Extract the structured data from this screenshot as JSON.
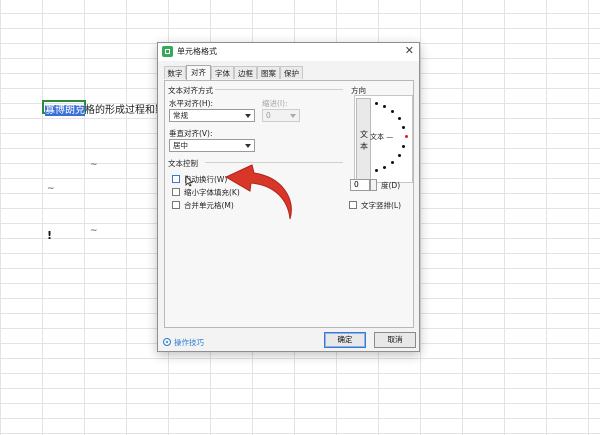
{
  "sheet": {
    "selected_cell_text_highlight": "寡博朗克",
    "selected_cell_text_rest": "格的形成过程和影",
    "row_marker": "!",
    "tilde_mark": "~"
  },
  "dialog": {
    "title": "单元格格式",
    "close_glyph": "✕",
    "tabs": [
      "数字",
      "对齐",
      "字体",
      "边框",
      "图案",
      "保护"
    ],
    "active_tab": "对齐",
    "text_alignment": {
      "group_label": "文本对齐方式",
      "horizontal_label": "水平对齐(H):",
      "horizontal_value": "常规",
      "indent_label": "缩进(I):",
      "indent_value": "0",
      "vertical_label": "垂直对齐(V):",
      "vertical_value": "居中"
    },
    "text_control": {
      "group_label": "文本控制",
      "wrap_text": "自动换行(W)",
      "shrink_to_fit": "缩小字体填充(K)",
      "merge_cells": "合并单元格(M)"
    },
    "orientation": {
      "group_label": "方向",
      "vertical_text_chars": [
        "文",
        "本"
      ],
      "horizontal_text": "文本 —",
      "degrees_value": "0",
      "degrees_label": "度(D)",
      "rtl_label": "文字竖排(L)"
    },
    "tips_link": "操作技巧",
    "ok_button": "确定",
    "cancel_button": "取消"
  },
  "colors": {
    "accent": "#3b77d4",
    "annotation_arrow": "#d9362a",
    "cell_border": "#2e8b3e"
  }
}
